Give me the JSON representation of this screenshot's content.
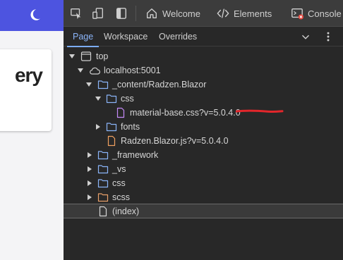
{
  "app": {
    "card_title": "ery",
    "icons": {
      "theme_toggle": "moon-icon"
    }
  },
  "devtools": {
    "toolbar": {
      "icons": [
        "inspect-icon",
        "device-toggle-icon",
        "dock-side-icon"
      ],
      "tabs": [
        {
          "label": "Welcome",
          "icon": "home-icon"
        },
        {
          "label": "Elements",
          "icon": "code-icon"
        },
        {
          "label": "Console",
          "icon": "console-icon",
          "badge_color": "#e8453c"
        }
      ]
    },
    "sources": {
      "tabs": [
        "Page",
        "Workspace",
        "Overrides"
      ],
      "active_tab": "Page",
      "controls": [
        "chevron-down-icon",
        "more-vert-icon"
      ],
      "tree": [
        {
          "label": "top",
          "icon": "frame-icon",
          "expanded": true
        },
        {
          "label": "localhost:5001",
          "icon": "cloud-icon",
          "expanded": true
        },
        {
          "label": "_content/Radzen.Blazor",
          "icon": "folder-icon",
          "expanded": true
        },
        {
          "label": "css",
          "icon": "folder-icon",
          "expanded": true
        },
        {
          "label": "material-base.css?v=5.0.4.0",
          "icon": "css-file-icon"
        },
        {
          "label": "fonts",
          "icon": "folder-icon",
          "expanded": false
        },
        {
          "label": "Radzen.Blazor.js?v=5.0.4.0",
          "icon": "js-file-icon"
        },
        {
          "label": "_framework",
          "icon": "folder-icon",
          "expanded": false
        },
        {
          "label": "_vs",
          "icon": "folder-icon",
          "expanded": false
        },
        {
          "label": "css",
          "icon": "folder-icon",
          "expanded": false
        },
        {
          "label": "scss",
          "icon": "folder-icon-orange",
          "expanded": false
        },
        {
          "label": "(index)",
          "icon": "document-icon",
          "selected": true
        }
      ]
    },
    "colors": {
      "folder": "#8ab4f8",
      "folder_orange": "#e8a06a",
      "css_file": "#c58af9",
      "js_file": "#f0a060",
      "annotation": "#e3262b",
      "accent": "#8ab4f8"
    }
  }
}
